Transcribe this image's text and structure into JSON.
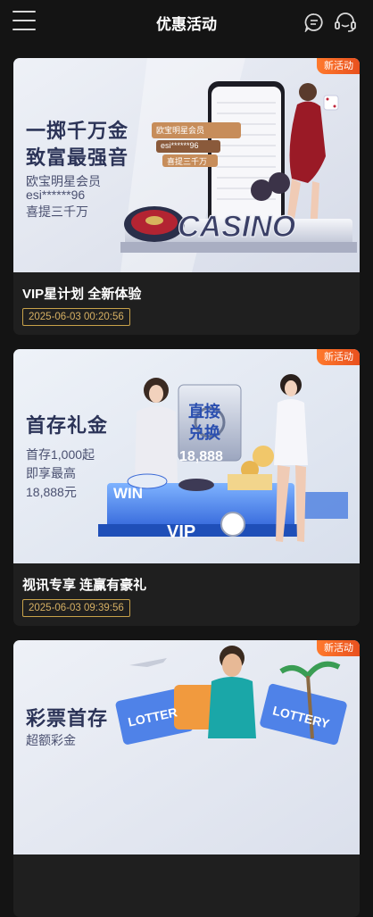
{
  "header": {
    "title": "优惠活动"
  },
  "badge_text": "新活动",
  "colors": {
    "background": "#141414",
    "card": "#1f1f1f",
    "badge": "#ff7a2d",
    "time_border": "#c8a24a"
  },
  "promotions": [
    {
      "title": "VIP星计划 全新体验",
      "time": "2025-06-03 00:20:56",
      "banner": {
        "headline1": "一掷千万金",
        "headline2": "致富最强音",
        "line1": "欧宝明星会员",
        "line2": "esi******96",
        "line3": "喜提三千万",
        "sign_top": "欧宝明星会员",
        "sign_mid": "esi******96",
        "sign_bottom": "喜提三千万",
        "logo": "CASINO"
      }
    },
    {
      "title": "视讯专享 连赢有豪礼",
      "time": "2025-06-03 09:39:56",
      "banner": {
        "headline": "首存礼金",
        "line1": "首存1,000起",
        "line2": "即享最高",
        "line3": "18,888元",
        "safe_text1": "直接",
        "safe_text2": "兑换",
        "amount": "18,888",
        "win": "WIN",
        "vip": "VIP"
      }
    },
    {
      "title": "",
      "time": "",
      "banner": {
        "headline": "彩票首存",
        "sub": "超额彩金",
        "lottery1": "LOTTER",
        "lottery2": "LOTTERY"
      }
    }
  ]
}
